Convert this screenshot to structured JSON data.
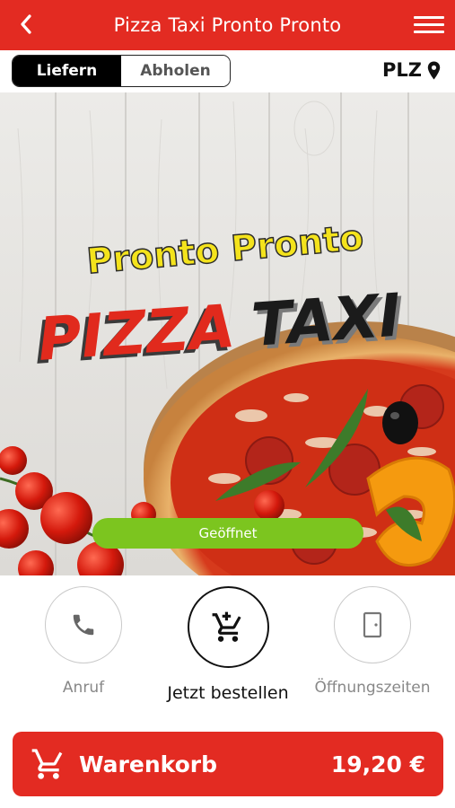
{
  "header": {
    "title": "Pizza Taxi Pronto Pronto"
  },
  "mode": {
    "deliver": "Liefern",
    "pickup": "Abholen",
    "active": "deliver"
  },
  "plz": {
    "label": "PLZ"
  },
  "hero": {
    "logo_line1": "Pronto Pronto",
    "logo_pizza": "PIZZA",
    "logo_taxi": "TAXI",
    "status": "Geöffnet"
  },
  "actions": {
    "call": "Anruf",
    "order": "Jetzt bestellen",
    "hours": "Öffnungszeiten"
  },
  "cart": {
    "label": "Warenkorb",
    "total": "19,20 €"
  },
  "colors": {
    "brand_red": "#e32b22",
    "open_green": "#7cc51f"
  }
}
